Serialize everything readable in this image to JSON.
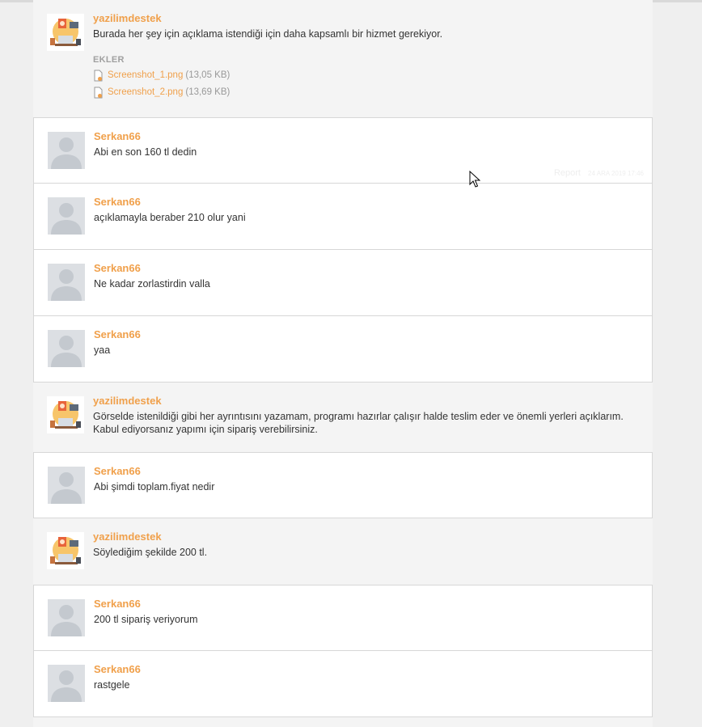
{
  "messages": [
    {
      "author": "yazilimdestek",
      "text": "Burada her şey için açıklama istendiği için daha kapsamlı bir hizmet gerekiyor.",
      "attachments_title": "EKLER",
      "attachments": [
        {
          "name": "Screenshot_1.png",
          "size": "(13,05 KB)"
        },
        {
          "name": "Screenshot_2.png",
          "size": "(13,69 KB)"
        }
      ]
    },
    {
      "author": "Serkan66",
      "text": "Abi en son 160 tl dedin",
      "report": "Report",
      "date": "24 ARA 2019 17:46"
    },
    {
      "author": "Serkan66",
      "text": "açıklamayla beraber 210 olur yani"
    },
    {
      "author": "Serkan66",
      "text": "Ne kadar zorlastirdin valla"
    },
    {
      "author": "Serkan66",
      "text": "yaa"
    },
    {
      "author": "yazilimdestek",
      "text": "Görselde istenildiği gibi her ayrıntısını yazamam, programı hazırlar çalışır halde teslim eder ve önemli yerleri açıklarım.\nKabul ediyorsanız yapımı için sipariş verebilirsiniz."
    },
    {
      "author": "Serkan66",
      "text": "Abi şimdi toplam.fiyat nedir"
    },
    {
      "author": "yazilimdestek",
      "text": "Söylediğim şekilde 200 tl."
    },
    {
      "author": "Serkan66",
      "text": "200 tl sipariş veriyorum"
    },
    {
      "author": "Serkan66",
      "text": "rastgele"
    }
  ],
  "colors": {
    "accent": "#f0a04b",
    "guest_bg": "#ffffff",
    "admin_bg": "#f4f4f4"
  },
  "icons": {
    "guest_avatar": "user-silhouette",
    "admin_avatar": "illustration-avatar",
    "attachment": "file-icon",
    "pointer": "mouse-pointer"
  }
}
